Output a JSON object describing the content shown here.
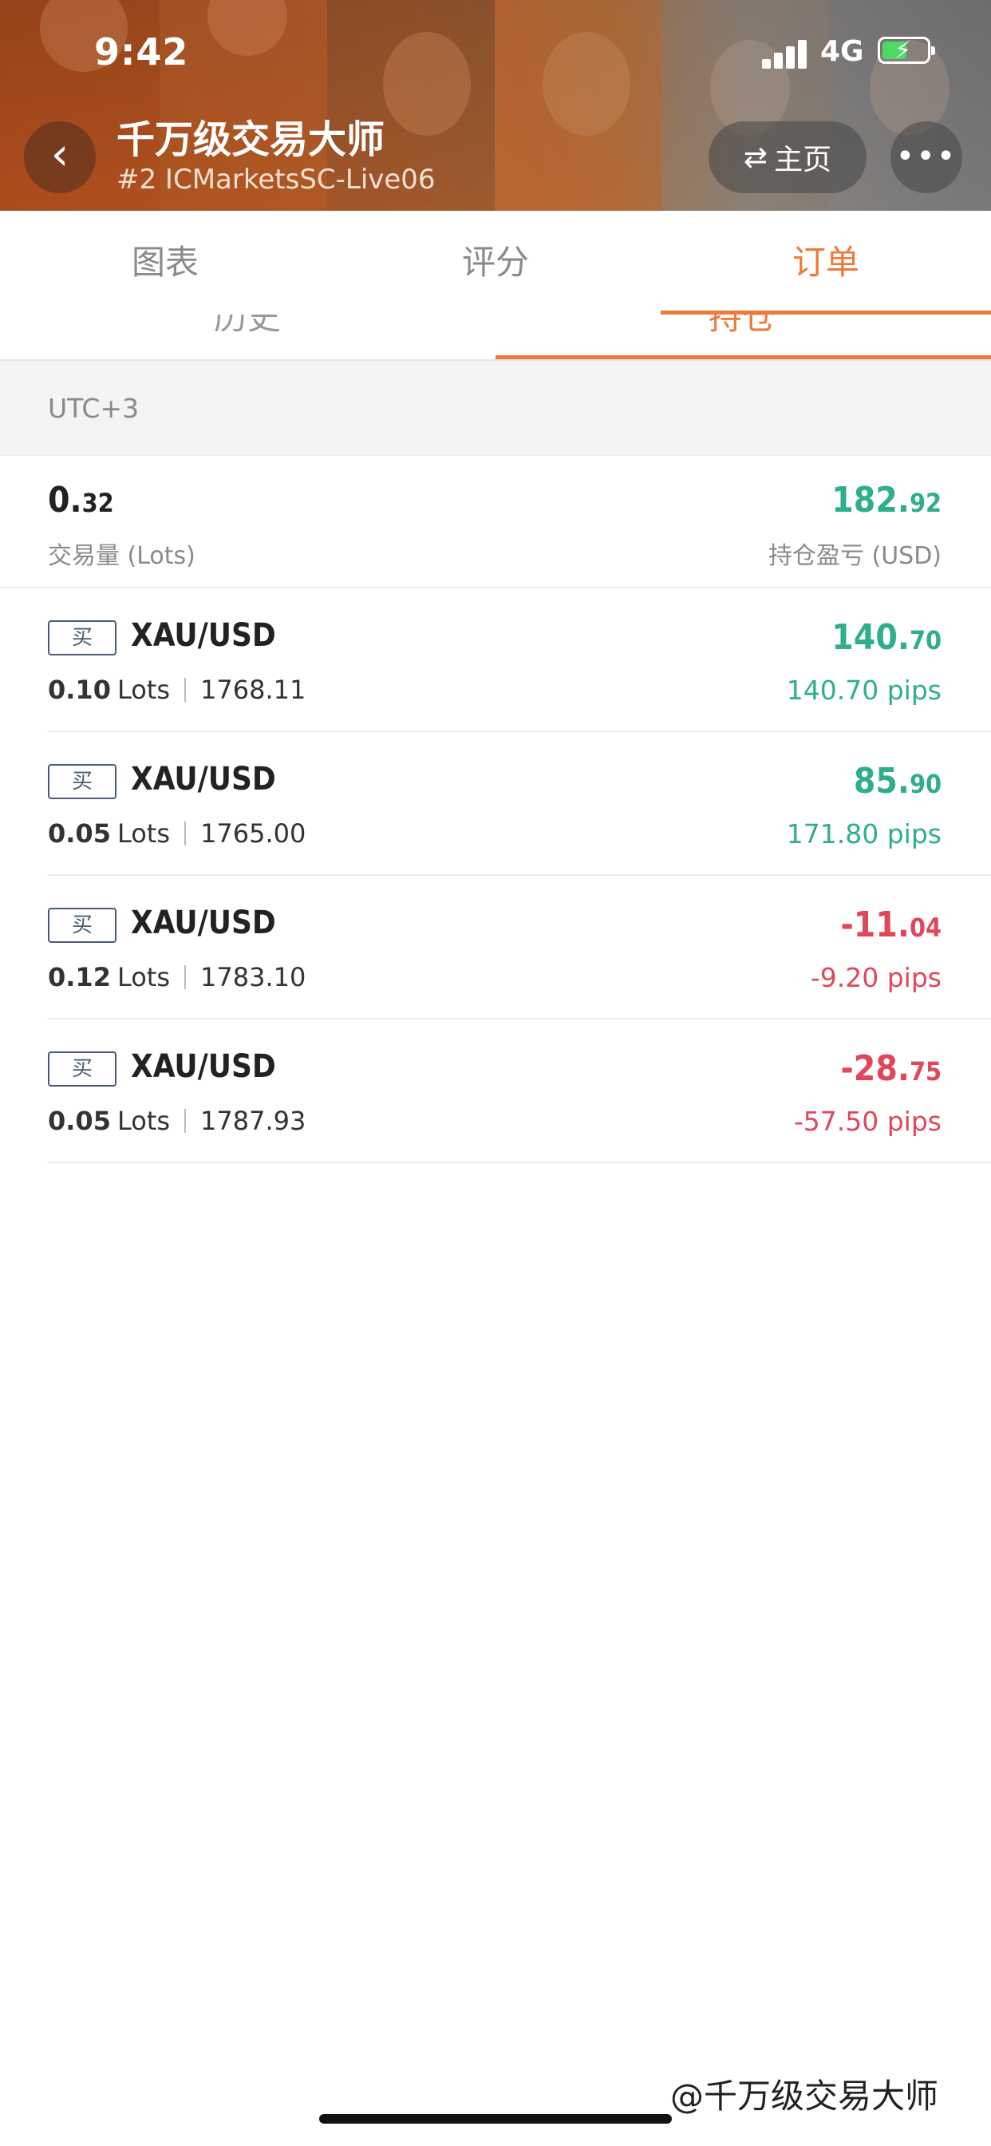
{
  "status_bar": {
    "time": "9:42",
    "network": "4G",
    "battery_bolt": "⚡"
  },
  "header": {
    "back_icon": "‹",
    "title": "千万级交易大师",
    "subtitle": "#2 ICMarketsSC-Live06",
    "home_icon": "⇄",
    "home_label": "主页",
    "more_icon": "•••"
  },
  "tabs": [
    {
      "label": "图表",
      "active": false
    },
    {
      "label": "评分",
      "active": false
    },
    {
      "label": "订单",
      "active": true
    }
  ],
  "subtabs": [
    {
      "label": "历史",
      "active": false
    },
    {
      "label": "持仓",
      "active": true
    }
  ],
  "timezone": "UTC+3",
  "summary": {
    "volume_int": "0.",
    "volume_dec": "32",
    "volume_label": "交易量 (Lots)",
    "profit_int": "182.",
    "profit_dec": "92",
    "profit_label": "持仓盈亏 (USD)"
  },
  "orders": [
    {
      "side": "买",
      "symbol": "XAU/USD",
      "lots": "0.10",
      "lots_unit": "Lots",
      "price": "1768.11",
      "pnl_int": "140.",
      "pnl_dec": "70",
      "pips": "140.70 pips",
      "positive": true
    },
    {
      "side": "买",
      "symbol": "XAU/USD",
      "lots": "0.05",
      "lots_unit": "Lots",
      "price": "1765.00",
      "pnl_int": "85.",
      "pnl_dec": "90",
      "pips": "171.80 pips",
      "positive": true
    },
    {
      "side": "买",
      "symbol": "XAU/USD",
      "lots": "0.12",
      "lots_unit": "Lots",
      "price": "1783.10",
      "pnl_int": "-11.",
      "pnl_dec": "04",
      "pips": "-9.20 pips",
      "positive": false
    },
    {
      "side": "买",
      "symbol": "XAU/USD",
      "lots": "0.05",
      "lots_unit": "Lots",
      "price": "1787.93",
      "pnl_int": "-28.",
      "pnl_dec": "75",
      "pips": "-57.50 pips",
      "positive": false
    }
  ],
  "watermark": "@千万级交易大师",
  "colors": {
    "accent": "#ee7a3a",
    "positive": "#2fae8c",
    "negative": "#e0475a"
  }
}
